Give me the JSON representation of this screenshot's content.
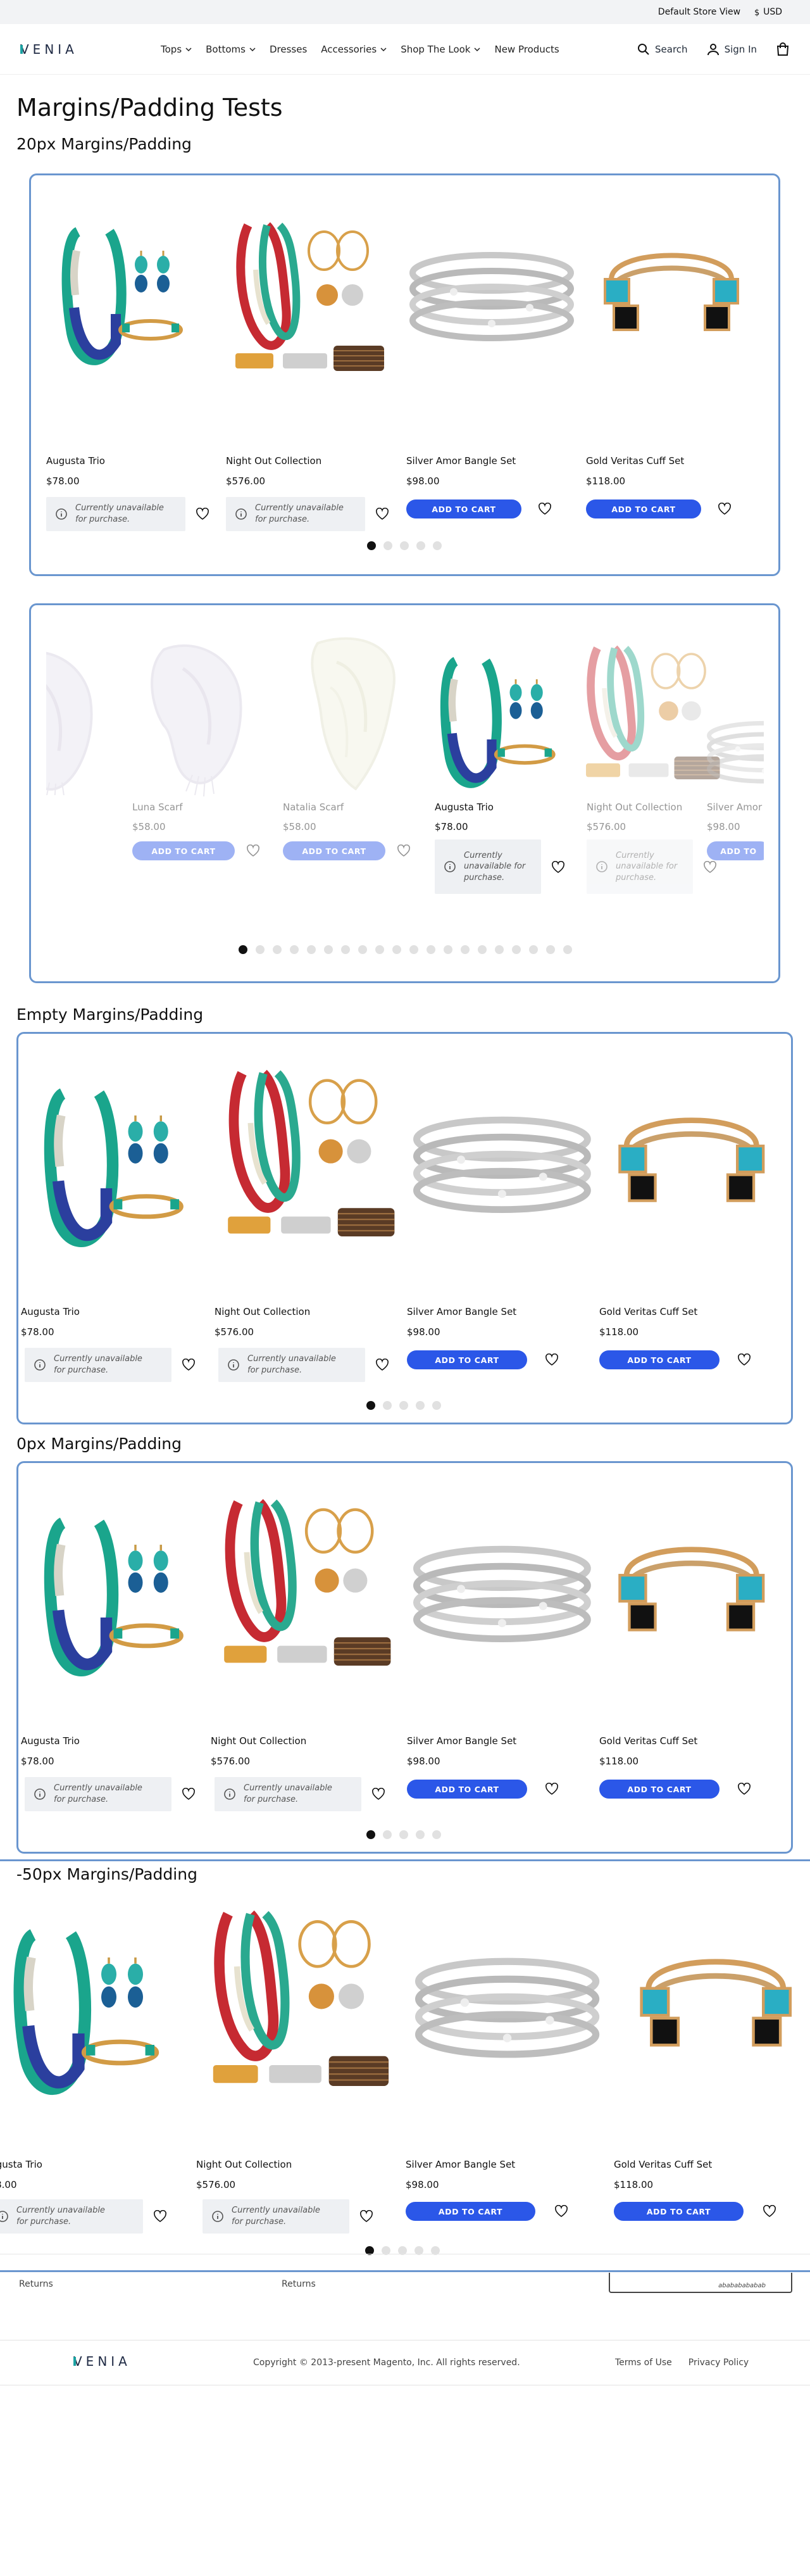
{
  "topbar": {
    "store_view": "Default Store View",
    "currency": "USD"
  },
  "header": {
    "nav": [
      "Tops",
      "Bottoms",
      "Dresses",
      "Accessories",
      "Shop The Look",
      "New Products"
    ],
    "nav_has_chevron": [
      true,
      true,
      false,
      true,
      true,
      false
    ],
    "search": "Search",
    "sign_in": "Sign In"
  },
  "page": {
    "title": "Margins/Padding Tests"
  },
  "sections": {
    "s20": "20px Margins/Padding",
    "empty": "Empty Margins/Padding",
    "zero": "0px Margins/Padding",
    "neg": "-50px Margins/Padding"
  },
  "products": {
    "augusta": {
      "name": "Augusta Trio",
      "price": "$78.00"
    },
    "nightout": {
      "name": "Night Out Collection",
      "price": "$576.00"
    },
    "silver": {
      "name": "Silver Amor Bangle Set",
      "price": "$98.00"
    },
    "gold": {
      "name": "Gold Veritas Cuff Set",
      "price": "$118.00"
    },
    "luna": {
      "name": "Luna Scarf",
      "price": "$58.00"
    },
    "natalia": {
      "name": "Natalia Scarf",
      "price": "$58.00"
    },
    "silver_cut": {
      "name": "Silver Amor",
      "price": "$98.00"
    }
  },
  "labels": {
    "add_to_cart": "ADD TO CART",
    "add_to_cart_cut": "ADD TO",
    "unavailable": "Currently unavailable for purchase."
  },
  "footer": {
    "returns_1": "Returns",
    "returns_2": "Returns",
    "boxed_text": "abababababab",
    "copyright": "Copyright © 2013-present Magento, Inc. All rights reserved.",
    "terms": "Terms of Use",
    "privacy": "Privacy Policy"
  },
  "colors": {
    "accent": "#2b57e8",
    "frame": "#6a96cf"
  }
}
